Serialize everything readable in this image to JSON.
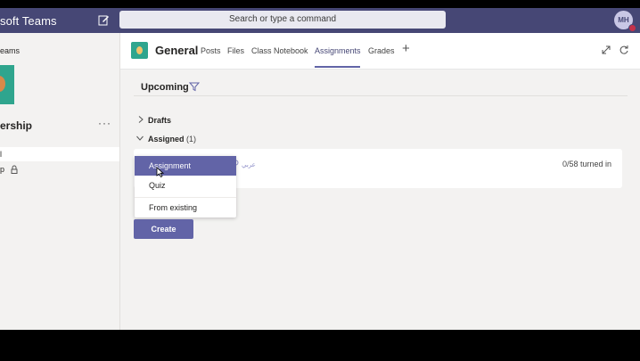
{
  "app": {
    "title": "soft Teams"
  },
  "search": {
    "placeholder": "Search or type a command"
  },
  "user": {
    "initials": "MH"
  },
  "leftpane": {
    "back_label": "eams",
    "team_name": "ership",
    "more_label": "···",
    "channels": [
      "l",
      "p"
    ]
  },
  "channel": {
    "title": "General",
    "tabs": [
      {
        "label": "Posts"
      },
      {
        "label": "Files"
      },
      {
        "label": "Class Notebook"
      },
      {
        "label": "Assignments"
      },
      {
        "label": "Grades"
      }
    ],
    "add_tab": "+"
  },
  "assignments": {
    "upcoming_label": "Upcoming",
    "drafts_label": "Drafts",
    "assigned_label": "Assigned",
    "assigned_count": "(1)",
    "card_sub": "عربي",
    "turned_in": "0/58 turned in"
  },
  "create_menu": {
    "items": [
      "Assignment",
      "Quiz",
      "From existing"
    ],
    "button": "Create"
  },
  "colors": {
    "accent": "#6264a7",
    "titlebar": "#464775",
    "team": "#2fa58e"
  },
  "icons": [
    "compose-icon",
    "filter-icon",
    "expand-icon",
    "refresh-icon",
    "lock-icon",
    "chevron-right-icon",
    "chevron-down-icon",
    "cursor-icon"
  ]
}
